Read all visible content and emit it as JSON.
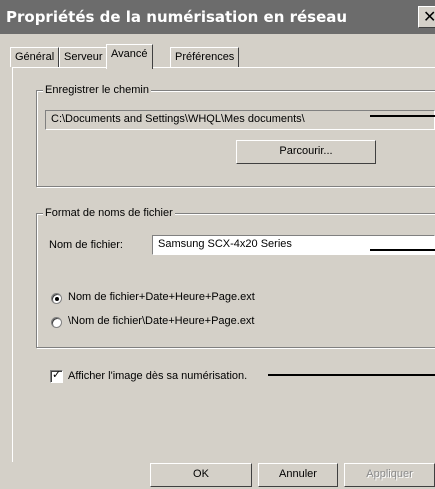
{
  "window": {
    "title": "Propriétés de la numérisation en réseau",
    "close_glyph": "✕"
  },
  "tabs": [
    {
      "label": "Général",
      "active": false
    },
    {
      "label": "Serveur",
      "active": false
    },
    {
      "label": "Avancé",
      "active": true
    },
    {
      "label": "Préférences",
      "active": false
    }
  ],
  "save_path": {
    "group_label": "Enregistrer le chemin",
    "path_value": "C:\\Documents and Settings\\WHQL\\Mes documents\\",
    "browse_label": "Parcourir..."
  },
  "filename_format": {
    "group_label": "Format de noms de fichier",
    "filename_label": "Nom de fichier:",
    "filename_value": "Samsung SCX-4x20 Series",
    "radio_options": [
      {
        "label": "Nom de fichier+Date+Heure+Page.ext",
        "selected": true
      },
      {
        "label": "\\Nom de fichier\\Date+Heure+Page.ext",
        "selected": false
      }
    ]
  },
  "show_image": {
    "label": "Afficher l'image dès sa numérisation.",
    "checked": true,
    "check_glyph": "✓"
  },
  "footer": {
    "ok_label": "OK",
    "cancel_label": "Annuler",
    "apply_label": "Appliquer",
    "apply_enabled": false
  }
}
